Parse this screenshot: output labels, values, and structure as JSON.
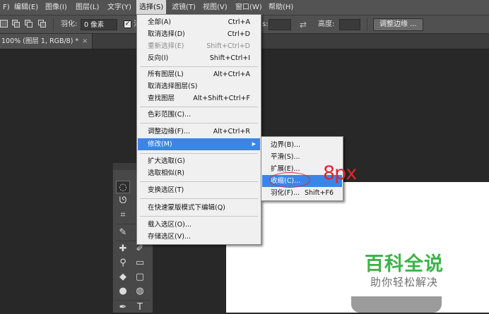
{
  "menubar": {
    "items": [
      {
        "label": "F)",
        "active": false
      },
      {
        "label": "编辑(E)",
        "active": false
      },
      {
        "label": "图像(I)",
        "active": false
      },
      {
        "label": "图层(L)",
        "active": false
      },
      {
        "label": "文字(Y)",
        "active": false
      },
      {
        "label": "选择(S)",
        "active": true
      },
      {
        "label": "滤镜(T)",
        "active": false
      },
      {
        "label": "视图(V)",
        "active": false
      },
      {
        "label": "窗口(W)",
        "active": false
      },
      {
        "label": "帮助(H)",
        "active": false
      }
    ]
  },
  "options": {
    "feather_label": "羽化:",
    "feather_value": "0 像素",
    "antialias_checked": true,
    "antialias_label": "消",
    "style_label": "s:",
    "height_label": "高度:",
    "refine_edge_button": "调整边缘 ..."
  },
  "document_tab": {
    "label": "100% (图层 1, RGB/8) *",
    "close_icon": "×"
  },
  "select_menu": {
    "items": [
      {
        "label": "全部(A)",
        "shortcut": "Ctrl+A"
      },
      {
        "label": "取消选择(D)",
        "shortcut": "Ctrl+D"
      },
      {
        "label": "重新选择(E)",
        "shortcut": "Shift+Ctrl+D",
        "disabled": true
      },
      {
        "label": "反向(I)",
        "shortcut": "Shift+Ctrl+I"
      },
      {
        "label": "所有图层(L)",
        "shortcut": "Alt+Ctrl+A"
      },
      {
        "label": "取消选择图层(S)",
        "shortcut": ""
      },
      {
        "label": "查找图层",
        "shortcut": "Alt+Shift+Ctrl+F"
      },
      {
        "label": "色彩范围(C)...",
        "shortcut": ""
      },
      {
        "label": "调整边缘(F)...",
        "shortcut": "Alt+Ctrl+R"
      },
      {
        "label": "修改(M)",
        "shortcut": "",
        "highlighted": true,
        "submenu": true
      },
      {
        "label": "扩大选取(G)",
        "shortcut": ""
      },
      {
        "label": "选取相似(R)",
        "shortcut": ""
      },
      {
        "label": "变换选区(T)",
        "shortcut": ""
      },
      {
        "label": "在快速蒙版模式下编辑(Q)",
        "shortcut": ""
      },
      {
        "label": "载入选区(O)...",
        "shortcut": ""
      },
      {
        "label": "存储选区(V)...",
        "shortcut": ""
      }
    ]
  },
  "modify_submenu": {
    "items": [
      {
        "label": "边界(B)...",
        "shortcut": ""
      },
      {
        "label": "平滑(S)...",
        "shortcut": ""
      },
      {
        "label": "扩展(E)...",
        "shortcut": ""
      },
      {
        "label": "收缩(C)...",
        "shortcut": "",
        "highlighted": true
      },
      {
        "label": "羽化(F)...",
        "shortcut": "Shift+F6"
      }
    ]
  },
  "annotation": {
    "text": "8px",
    "color": "#e0252d"
  },
  "watermark": {
    "title": "百科全说",
    "subtitle": "助你轻松解决",
    "title_color": "#3bb44a"
  },
  "tools": {
    "icons": [
      "marquee-icon",
      "lasso-icon",
      "crop-icon",
      "eyedropper-icon",
      "healing-brush-icon",
      "brush-icon",
      "clone-stamp-icon",
      "history-brush-icon",
      "eraser-icon",
      "gradient-icon",
      "blur-icon",
      "dodge-icon",
      "pen-icon",
      "type-icon",
      "path-select-icon",
      "shape-icon"
    ]
  },
  "colors": {
    "menu_highlight": "#3c85e8",
    "menubar_bg": "#535353",
    "workspace_bg": "#282828"
  }
}
